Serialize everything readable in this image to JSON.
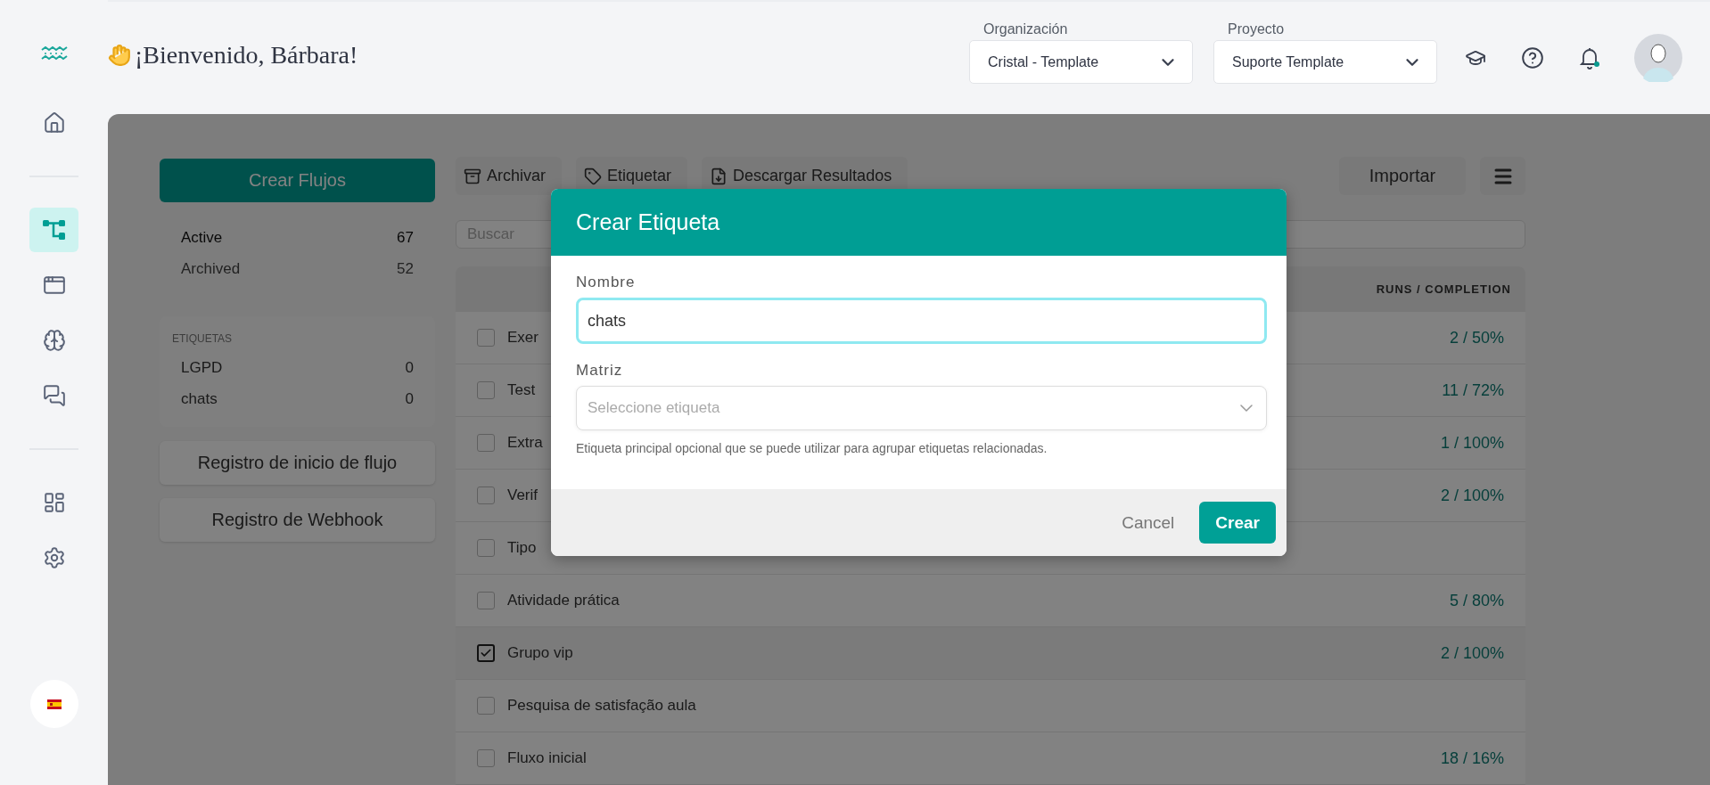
{
  "header": {
    "greeting": "¡Bienvenido, Bárbara!",
    "selectors": [
      {
        "label": "Organización",
        "value": "Cristal - Template"
      },
      {
        "label": "Proyecto",
        "value": "Suporte Template"
      }
    ]
  },
  "nav": {
    "groups": [
      [
        {
          "kind": "home",
          "selected": false
        }
      ],
      [
        {
          "kind": "flows",
          "selected": true
        },
        {
          "kind": "window",
          "selected": false
        },
        {
          "kind": "brain",
          "selected": false
        },
        {
          "kind": "chat",
          "selected": false
        }
      ],
      [
        {
          "kind": "dashboard",
          "selected": false
        },
        {
          "kind": "settings",
          "selected": false
        }
      ]
    ]
  },
  "sidebar": {
    "create_button": "Crear Flujos",
    "filters": [
      {
        "label": "Active",
        "count": "67",
        "selected": true
      },
      {
        "label": "Archived",
        "count": "52",
        "selected": false
      }
    ],
    "tags_heading": "ETIQUETAS",
    "tags": [
      {
        "label": "LGPD",
        "count": "0"
      },
      {
        "label": "chats",
        "count": "0"
      }
    ],
    "buttons": [
      "Registro de inicio de flujo",
      "Registro de Webhook"
    ]
  },
  "toolbar": {
    "actions": [
      {
        "kind": "archive",
        "label": "Archivar"
      },
      {
        "kind": "tag",
        "label": "Etiquetar"
      },
      {
        "kind": "download",
        "label": "Descargar Resultados"
      }
    ],
    "import_button": "Importar"
  },
  "search": {
    "placeholder": "Buscar"
  },
  "table": {
    "columns": [
      "RUNS / COMPLETION"
    ],
    "rows": [
      {
        "name": "Exer",
        "runs": "2 / 50%",
        "checked": false
      },
      {
        "name": "Test",
        "runs": "11 / 72%",
        "checked": false
      },
      {
        "name": "Extra",
        "runs": "1 / 100%",
        "checked": false
      },
      {
        "name": "Verif",
        "runs": "2 / 100%",
        "checked": false
      },
      {
        "name": "Tipo",
        "checked": false
      },
      {
        "name": "Atividade prática",
        "runs": "5 / 80%",
        "checked": false
      },
      {
        "name": "Grupo vip",
        "runs": "2 / 100%",
        "checked": true
      },
      {
        "name": "Pesquisa de satisfação aula",
        "checked": false
      },
      {
        "name": "Fluxo inicial",
        "runs": "18 / 16%",
        "checked": false
      }
    ]
  },
  "dialog": {
    "title": "Crear Etiqueta",
    "fields": [
      {
        "kind": "text",
        "label": "Nombre",
        "value": "chats",
        "focused": true
      },
      {
        "kind": "select",
        "label": "Matriz",
        "placeholder": "Seleccione etiqueta",
        "help": "Etiqueta principal opcional que se puede utilizar para agrupar etiquetas relacionadas.",
        "focused": false
      }
    ],
    "buttons": [
      {
        "kind": "secondary",
        "label": "Cancel"
      },
      {
        "kind": "primary",
        "label": "Crear"
      }
    ]
  }
}
